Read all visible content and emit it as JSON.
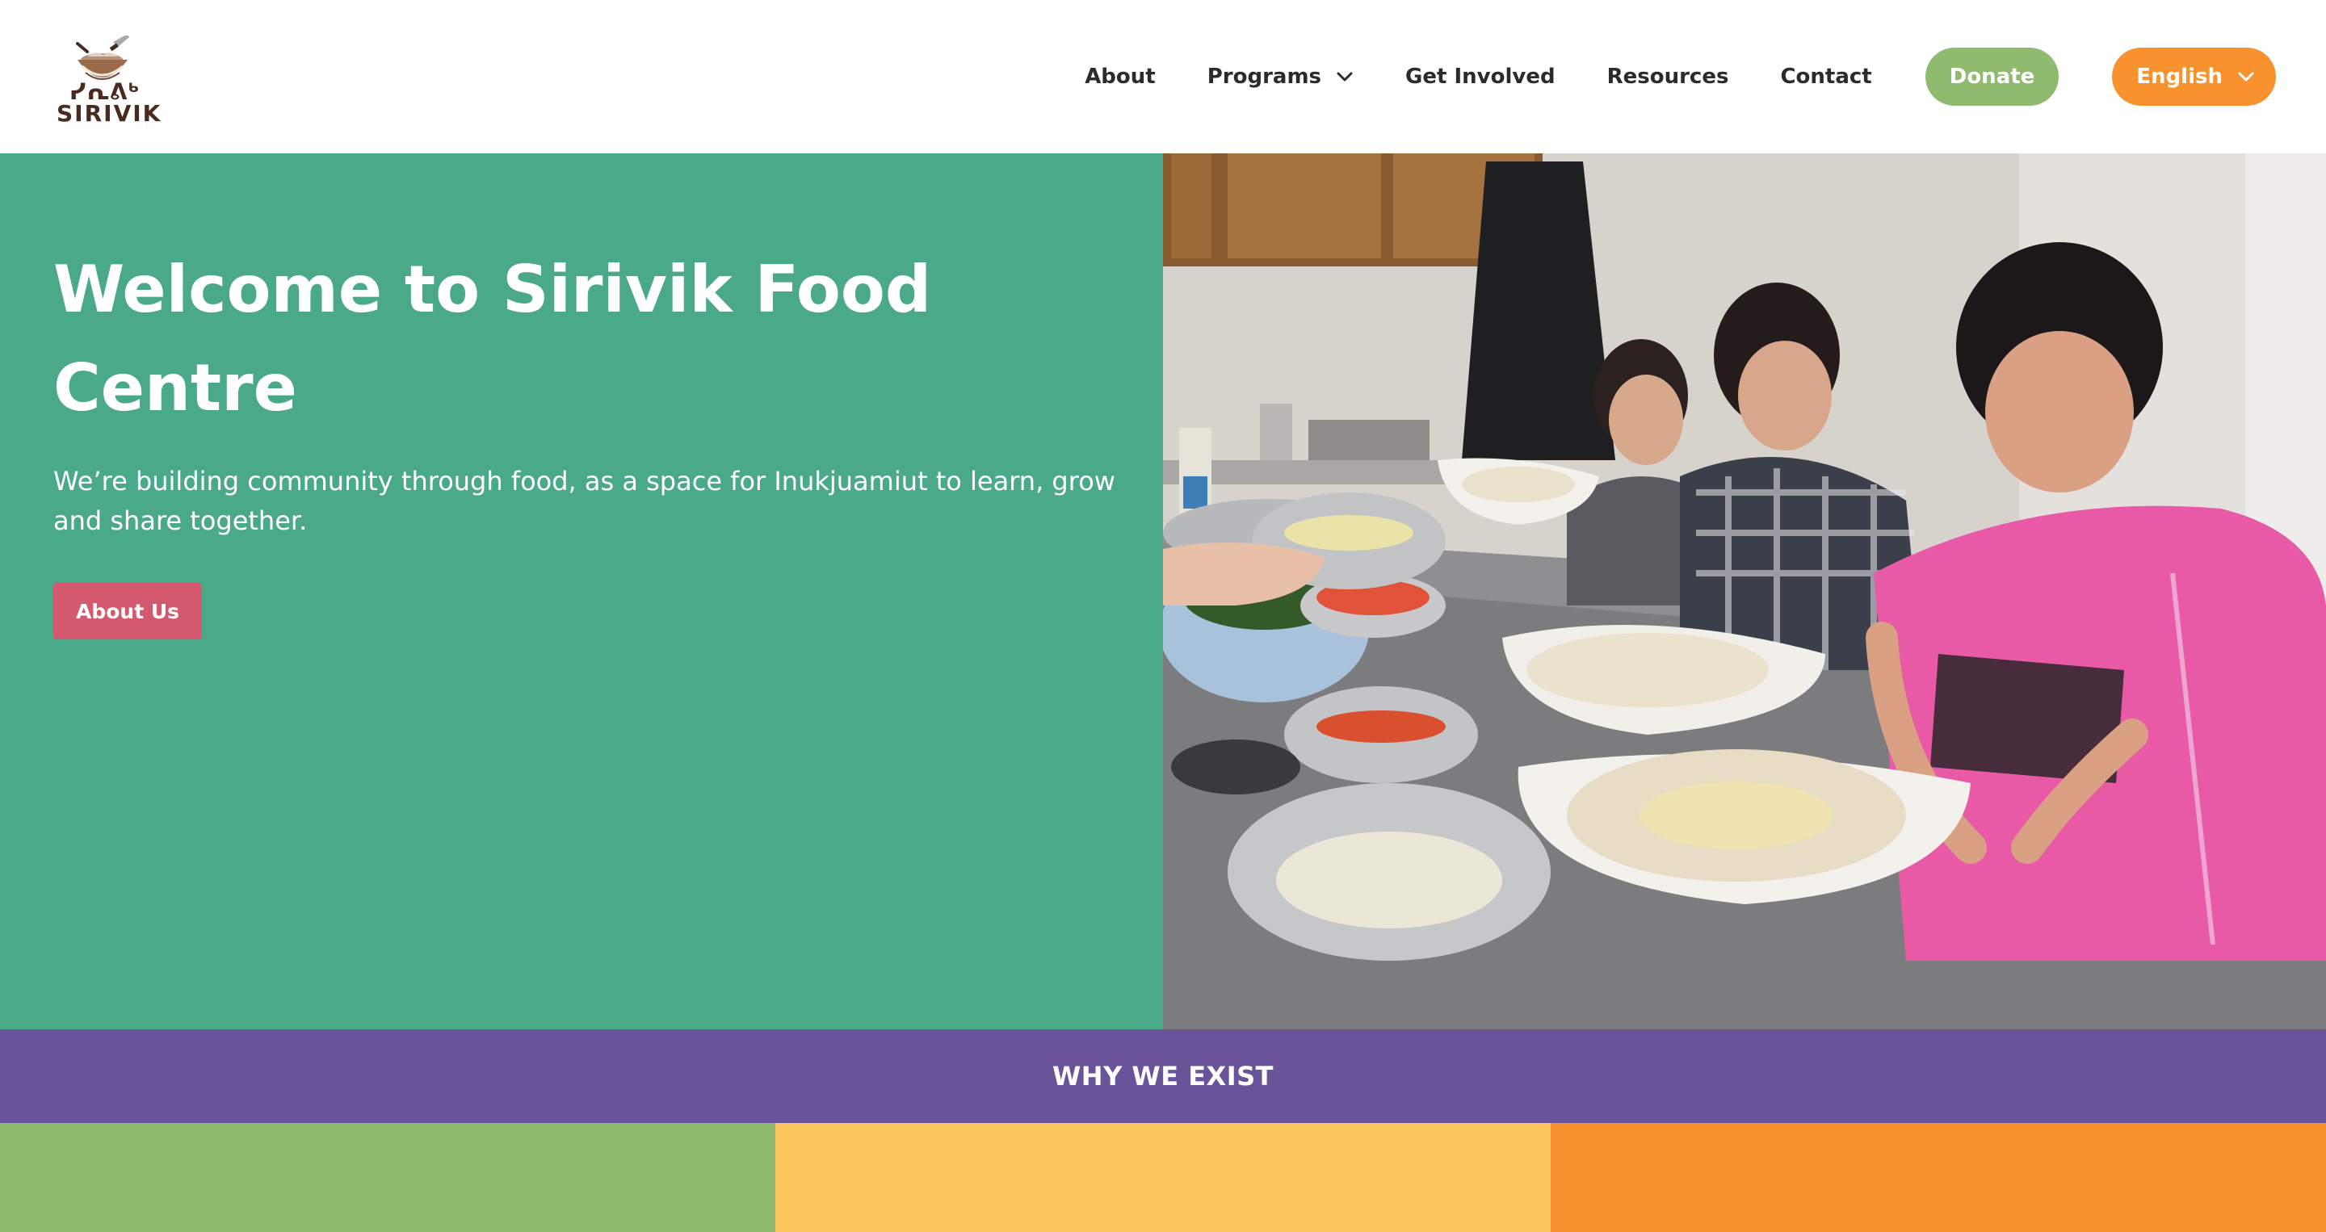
{
  "brand": {
    "syllabics": "ᓯᕆᕕᒃ",
    "name": "SIRIVIK",
    "logo_icon": "bowl-with-knife-icon"
  },
  "nav": {
    "items": [
      {
        "label": "About"
      },
      {
        "label": "Programs",
        "has_dropdown": true
      },
      {
        "label": "Get Involved"
      },
      {
        "label": "Resources"
      },
      {
        "label": "Contact"
      }
    ],
    "donate_label": "Donate",
    "language_label": "English"
  },
  "hero": {
    "title": "Welcome to Sirivik Food Centre",
    "subtitle": "We’re building community through food, as a space for Inukjuamiut to learn, grow and share together.",
    "cta_label": "About Us",
    "image_subject": "children-preparing-dough-in-kitchen-photo"
  },
  "why": {
    "title": "WHY WE EXIST"
  },
  "colors": {
    "hero_bg": "#4aa989",
    "why_band": "#6a5499",
    "donate": "#8fbb6e",
    "language": "#f7922f",
    "cta": "#d35a6e",
    "block_green": "#8fbb6e",
    "block_yellow": "#f9c75b",
    "block_orange": "#f7922f",
    "logo_brown": "#4a2a1f"
  }
}
